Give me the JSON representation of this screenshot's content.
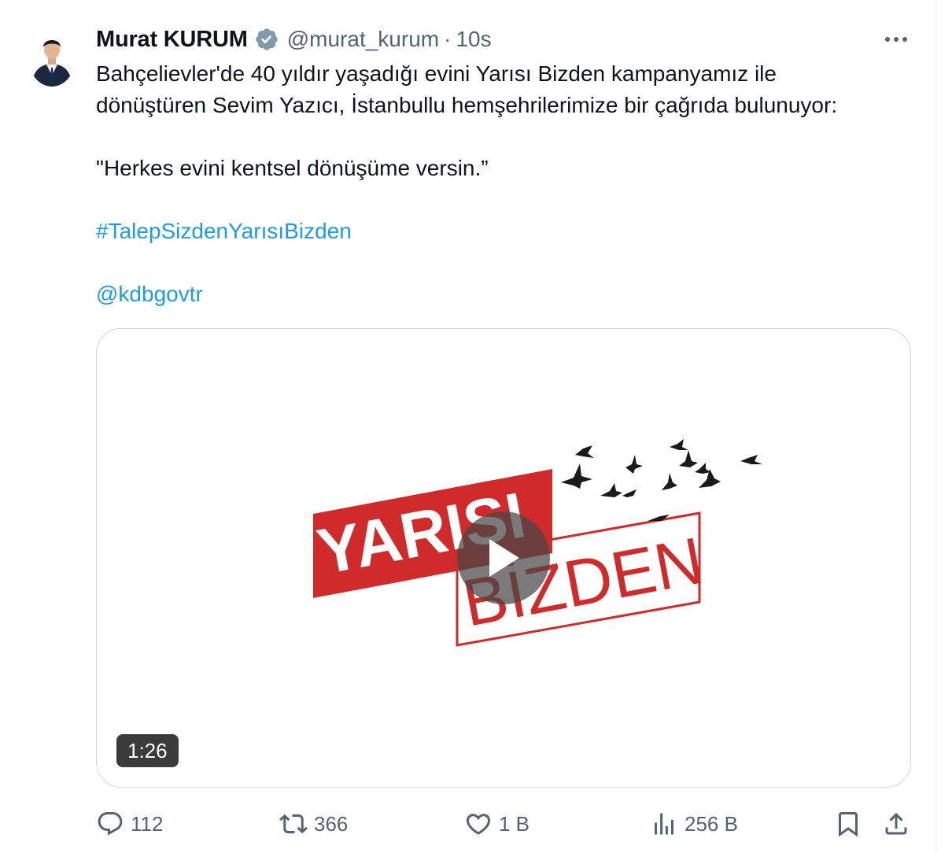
{
  "tweet": {
    "author_name": "Murat KURUM",
    "handle": "@murat_kurum",
    "separator": "·",
    "time": "10s",
    "text": {
      "line1": "Bahçelievler'de 40 yıldır yaşadığı evini Yarısı Bizden kampanyamız ile",
      "line2": "dönüştüren Sevim Yazıcı, İstanbullu hemşehrilerimize bir çağrıda bulunuyor:",
      "quote": "\"Herkes evini kentsel dönüşüme versin.”",
      "hashtag": "#TalepSizdenYarısıBizden",
      "mention": "@kdbgovtr"
    },
    "media": {
      "logo_word1": "YARISI",
      "logo_word2": "BİZDEN",
      "duration": "1:26",
      "logo_red": "#d02a2a"
    },
    "actions": {
      "replies": "112",
      "reposts": "366",
      "likes": "1 B",
      "views": "256 B"
    },
    "colors": {
      "text": "#0f1419",
      "secondary": "#536471",
      "link": "#1d9bf0",
      "border": "#cfd9de"
    }
  }
}
